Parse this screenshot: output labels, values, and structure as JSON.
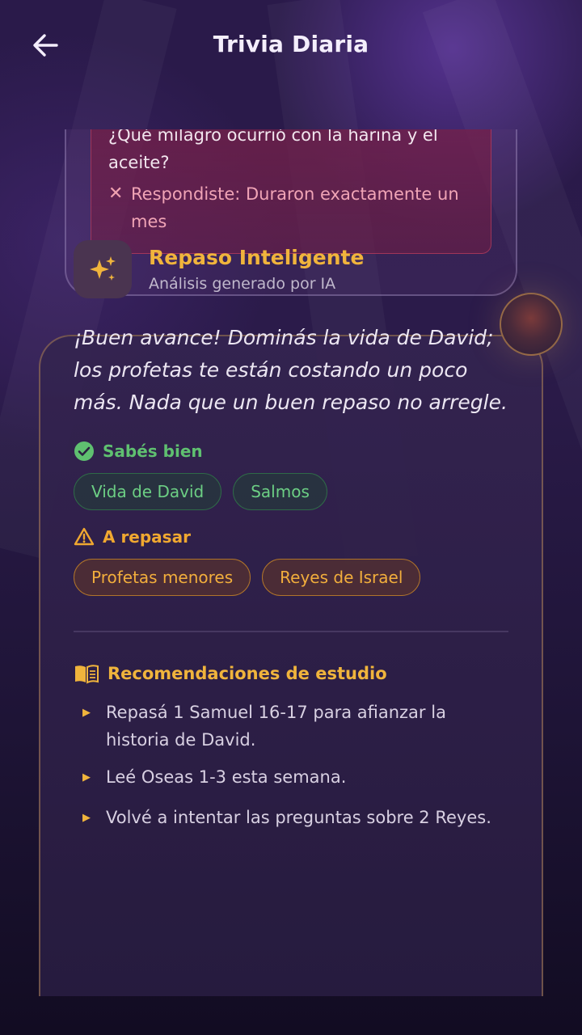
{
  "header": {
    "title": "Trivia Diaria",
    "back_icon": "arrow-left-icon"
  },
  "previous_question": {
    "question": "¿Qué milagro ocurrió con la harina y el aceite?",
    "answer_prefix_icon": "x-icon",
    "your_answer": "Respondiste: Duraron exactamente un mes"
  },
  "smart_review": {
    "icon": "sparkles-icon",
    "title": "Repaso Inteligente",
    "subtitle": "Análisis generado por IA",
    "summary": "¡Buen avance! Dominás la vida de David; los profetas te están costando un poco más. Nada que un buen repaso no arregle.",
    "strengths": {
      "label": "Sabés bien",
      "icon": "check-circle-icon",
      "color": "#5fc070",
      "topics": [
        "Vida de David",
        "Salmos"
      ]
    },
    "weaknesses": {
      "label": "A repasar",
      "icon": "warning-icon",
      "color": "#f0a830",
      "topics": [
        "Profetas menores",
        "Reyes de Israel"
      ]
    },
    "recommendations": {
      "label": "Recomendaciones de estudio",
      "icon": "book-icon",
      "items": [
        "Repasá 1 Samuel 16-17 para afianzar la historia de David.",
        "Leé Oseas 1-3 esta semana.",
        "Volvé a intentar las preguntas sobre 2 Reyes."
      ]
    }
  },
  "colors": {
    "accent_gold": "#f0b43c",
    "background": "#2a1a4a"
  }
}
